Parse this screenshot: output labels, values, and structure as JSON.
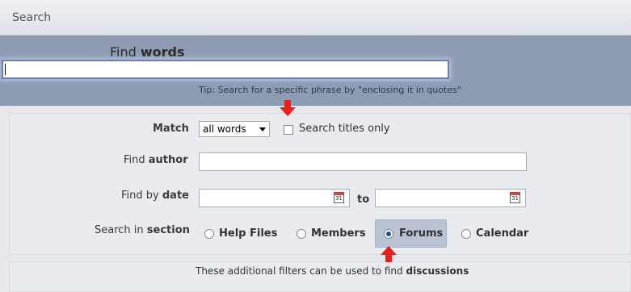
{
  "header": {
    "title": "Search"
  },
  "find": {
    "label_prefix": "Find",
    "label_bold": "words",
    "value": "",
    "tip": "Tip: Search for a specific phrase by \"enclosing it in quotes\""
  },
  "match": {
    "label": "Match",
    "selected": "all words",
    "titles_only_label": "Search titles only",
    "titles_only_checked": false
  },
  "author": {
    "label_prefix": "Find",
    "label_bold": "author",
    "value": ""
  },
  "date": {
    "label_prefix": "Find by",
    "label_bold": "date",
    "to_label": "to",
    "from_value": "",
    "to_value": ""
  },
  "section": {
    "label_prefix": "Search in",
    "label_bold": "section",
    "options": [
      "Help Files",
      "Members",
      "Forums",
      "Calendar"
    ],
    "selected": "Forums"
  },
  "filters": {
    "text": "These additional filters can be used to find",
    "bold": "discussions"
  },
  "colors": {
    "accent_arrow": "#e8201f",
    "find_panel": "#8f9bb2",
    "selected_option_bg": "#b9c3d3"
  },
  "icons": [
    "calendar-icon",
    "red-arrow-down-icon",
    "red-arrow-up-icon",
    "dropdown-arrow-icon"
  ]
}
